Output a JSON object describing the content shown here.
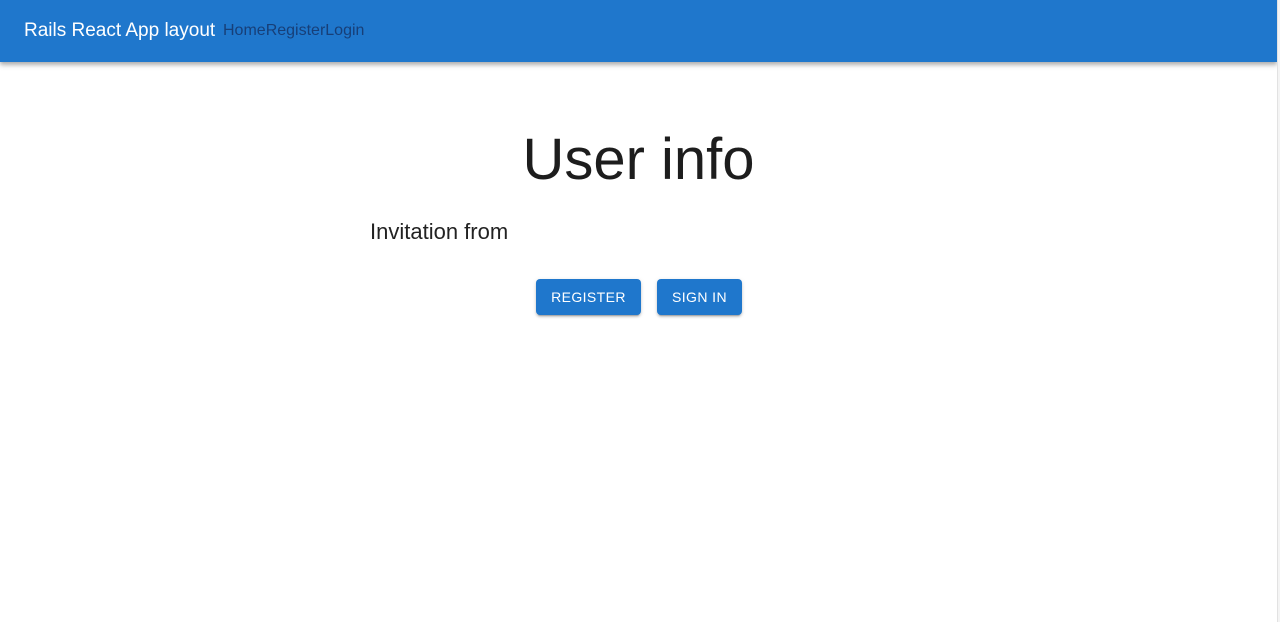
{
  "appbar": {
    "brand": "Rails React App layout",
    "nav": {
      "home": "Home",
      "register": "Register",
      "login": "Login"
    },
    "color": "#1f77cc"
  },
  "main": {
    "title": "User info",
    "invitation_text": "Invitation from",
    "buttons": {
      "register": "REGISTER",
      "sign_in": "SIGN IN"
    }
  }
}
